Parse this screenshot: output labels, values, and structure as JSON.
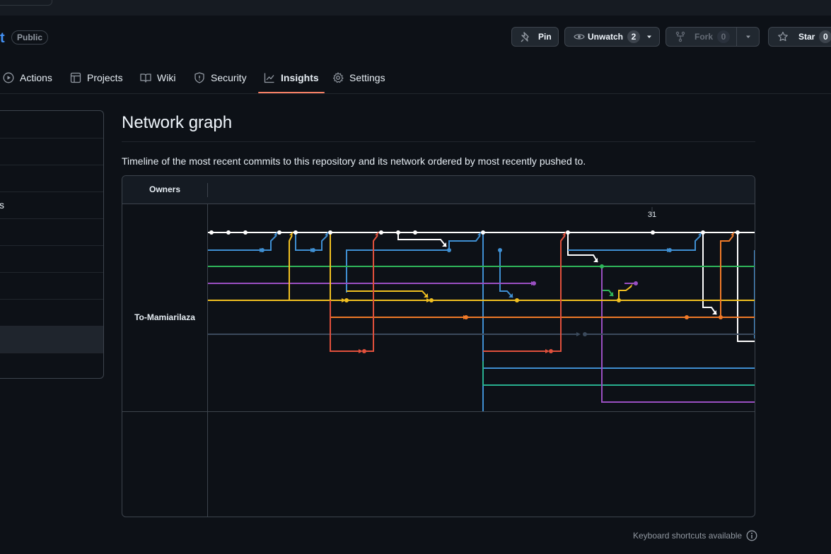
{
  "repo": {
    "name_fragment": "t",
    "visibility": "Public"
  },
  "actions": {
    "pin": "Pin",
    "unwatch": "Unwatch",
    "unwatch_count": "2",
    "fork": "Fork",
    "fork_count": "0",
    "star": "Star",
    "star_count": "0"
  },
  "tabs": [
    {
      "label": "Actions",
      "icon": "play-icon"
    },
    {
      "label": "Projects",
      "icon": "table-icon"
    },
    {
      "label": "Wiki",
      "icon": "book-icon"
    },
    {
      "label": "Security",
      "icon": "shield-icon"
    },
    {
      "label": "Insights",
      "icon": "graph-icon",
      "active": true
    },
    {
      "label": "Settings",
      "icon": "gear-icon"
    }
  ],
  "sidebar": {
    "items": [
      "",
      "",
      "",
      "s",
      "",
      "",
      "",
      "",
      "",
      ""
    ],
    "selected_index": 8
  },
  "page": {
    "title": "Network graph",
    "description": "Timeline of the most recent commits to this repository and its network ordered by most recently pushed to."
  },
  "graph": {
    "owners_header": "Owners",
    "owner": "To-Mamiarilaza",
    "date_label": "31"
  },
  "footer": {
    "keyboard": "Keyboard shortcuts available"
  },
  "colors": {
    "white": "#ffffff",
    "blue": "#3f8fd2",
    "green": "#2fb65a",
    "purple": "#9a4fc2",
    "yellow": "#f1c021",
    "orange": "#f07a28",
    "red": "#e0503c",
    "slate": "#3b4a5c",
    "teal": "#28b08f",
    "accent_tab": "#f78166"
  }
}
